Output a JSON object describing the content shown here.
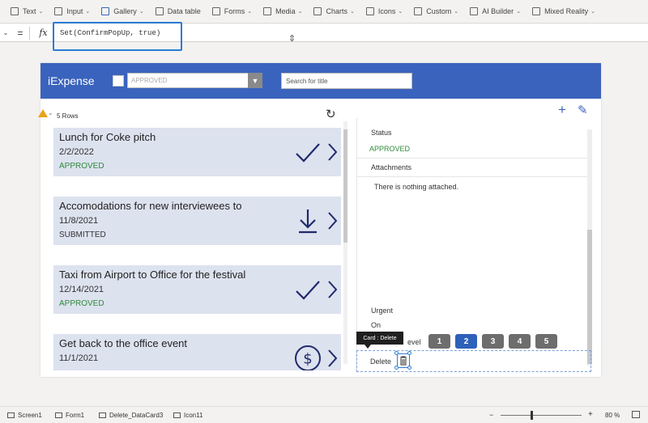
{
  "ribbon": {
    "items": [
      {
        "label": "Text",
        "icon": "text-icon"
      },
      {
        "label": "Input",
        "icon": "input-icon"
      },
      {
        "label": "Gallery",
        "icon": "gallery-icon"
      },
      {
        "label": "Data table",
        "icon": "table-icon"
      },
      {
        "label": "Forms",
        "icon": "forms-icon"
      },
      {
        "label": "Media",
        "icon": "media-icon"
      },
      {
        "label": "Charts",
        "icon": "chart-icon"
      },
      {
        "label": "Icons",
        "icon": "icons-icon"
      },
      {
        "label": "Custom",
        "icon": "custom-icon"
      },
      {
        "label": "AI Builder",
        "icon": "ai-icon"
      },
      {
        "label": "Mixed Reality",
        "icon": "mixed-reality-icon"
      }
    ]
  },
  "formula_bar": {
    "equals": "=",
    "fx": "fx",
    "formula": "Set(ConfirmPopUp, true)"
  },
  "app": {
    "title": "iExpense",
    "filter_placeholder": "APPROVED",
    "search_placeholder": "Search for title",
    "rows_label": "5 Rows",
    "accent": "#3a63bd"
  },
  "gallery": [
    {
      "title": "Lunch for Coke pitch",
      "date": "2/2/2022",
      "status": "APPROVED",
      "icon": "check-icon"
    },
    {
      "title": "Accomodations for new interviewees to",
      "date": "11/8/2021",
      "status": "SUBMITTED",
      "icon": "download-icon"
    },
    {
      "title": "Taxi from Airport to Office for the festival",
      "date": "12/14/2021",
      "status": "APPROVED",
      "icon": "check-icon"
    },
    {
      "title": "Get back to the office event",
      "date": "11/1/2021",
      "status": "",
      "icon": "dollar-icon"
    }
  ],
  "form": {
    "status_label": "Status",
    "status_value": "APPROVED",
    "attachments_label": "Attachments",
    "attachments_empty": "There is nothing attached.",
    "urgent_label": "Urgent",
    "urgent_value": "On",
    "priority_label_partial": "evel",
    "priority_options": [
      "1",
      "2",
      "3",
      "4",
      "5"
    ],
    "priority_selected": "2",
    "delete_label": "Delete",
    "tooltip": "Card : Delete"
  },
  "statusbar": {
    "crumbs": [
      "Screen1",
      "Form1",
      "Delete_DataCard3",
      "Icon11"
    ],
    "zoom_minus": "−",
    "zoom_plus": "+",
    "zoom": "80 %",
    "zoom_level": 0.8
  }
}
